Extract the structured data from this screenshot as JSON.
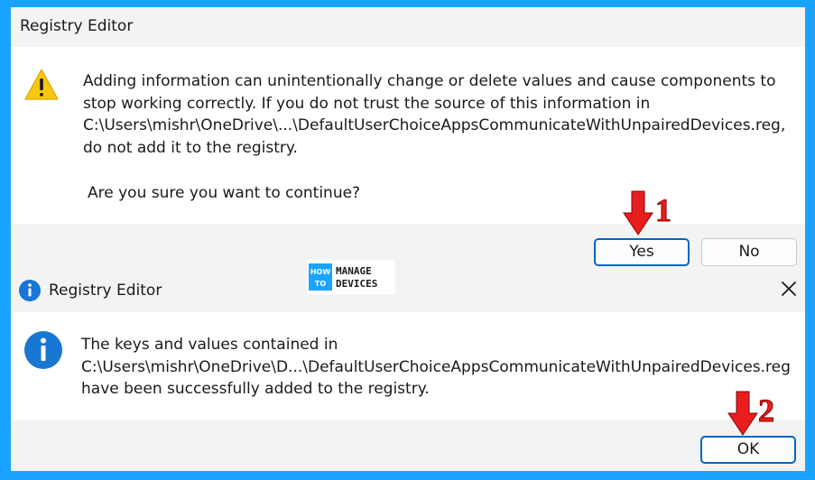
{
  "dialog1": {
    "title": "Registry Editor",
    "icon": "warning-icon",
    "message_lines": [
      "Adding information can unintentionally change or delete values and cause components to",
      "stop working correctly. If you do not trust the source of this information in",
      "C:\\Users\\mishr\\OneDrive\\...\\DefaultUserChoiceAppsCommunicateWithUnpairedDevices.reg,",
      "do not add it to the registry."
    ],
    "question": "Are you sure you want to continue?",
    "buttons": {
      "yes": "Yes",
      "no": "No"
    }
  },
  "dialog2": {
    "title": "Registry Editor",
    "icon": "info-icon",
    "message_lines": [
      "The keys and values contained in",
      "C:\\Users\\mishr\\OneDrive\\D...\\DefaultUserChoiceAppsCommunicateWithUnpairedDevices.reg",
      "have been successfully added to the registry."
    ],
    "buttons": {
      "ok": "OK"
    }
  },
  "annotations": {
    "step1": "1",
    "step2": "2",
    "arrow_color": "#e81e1e"
  },
  "logo": {
    "line1a": "HOW",
    "line1b": "MANAGE",
    "line2a": "TO",
    "line2b": "DEVICES"
  },
  "colors": {
    "background": "#1aa3ff",
    "accent": "#0067c0",
    "warning": "#f9c80e",
    "info": "#0a66c2"
  }
}
